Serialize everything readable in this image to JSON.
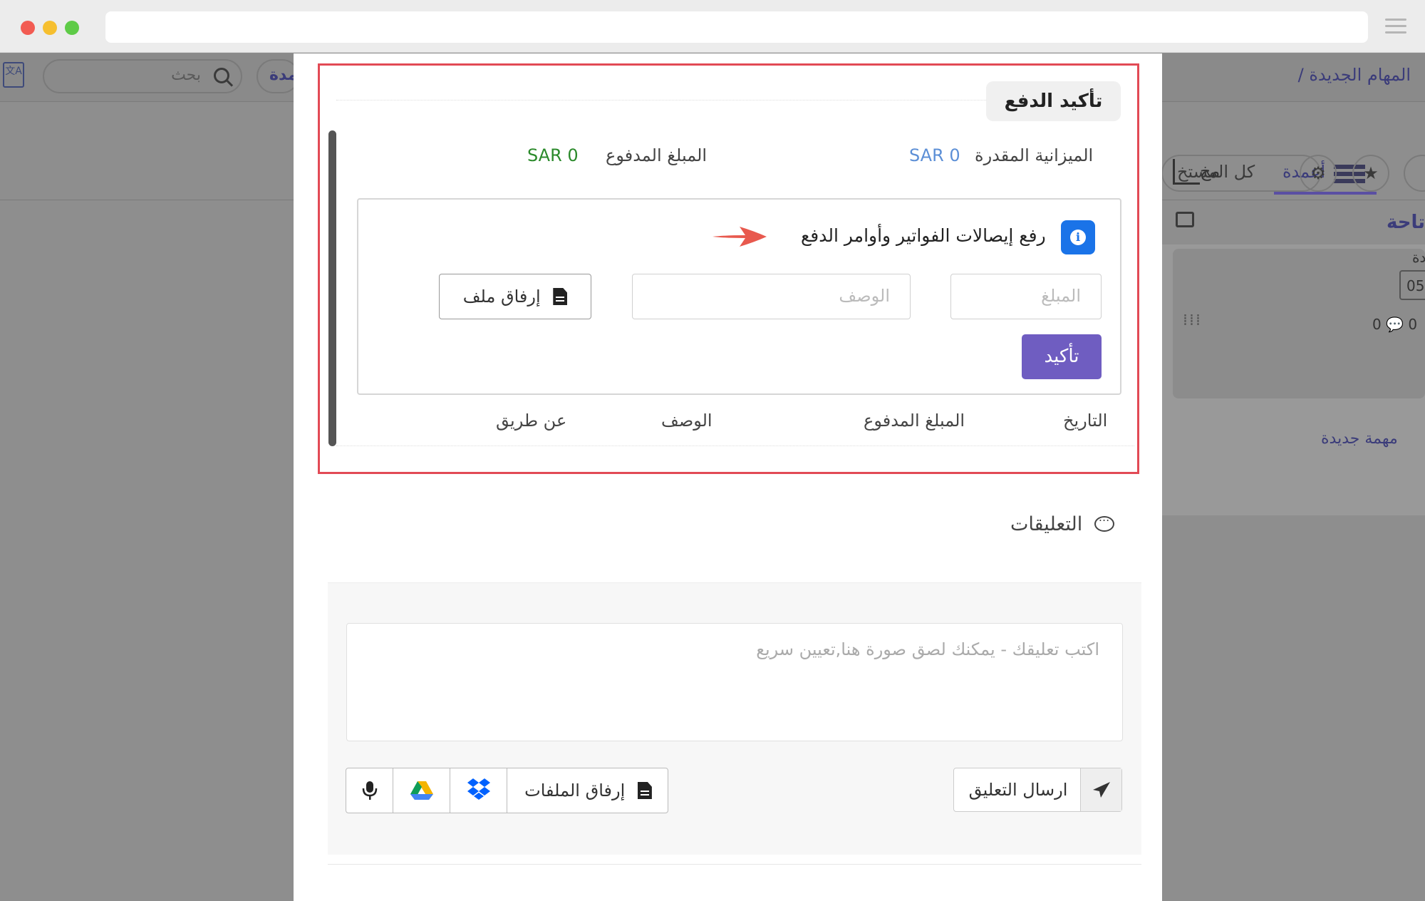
{
  "background_app": {
    "search_placeholder": "بحث",
    "columns_pill_partial": "مدة",
    "breadcrumb": "/ المهام الجديدة",
    "tab_columns": "أعمدة",
    "tab_other_partial": "مخ",
    "all_users_partial": "كل المستخ",
    "card_title_partial": "تاحة",
    "card_label_partial": "دة",
    "card_value_partial": "05",
    "card_comment_count": "0",
    "card_other_count": "0",
    "new_task_link": "مهمة جديدة"
  },
  "payment": {
    "section_title": "تأكيد الدفع",
    "estimated_budget_label": "الميزانية المقدرة",
    "estimated_budget_value": "SAR 0",
    "paid_amount_label": "المبلغ المدفوع",
    "paid_amount_value": "SAR 0",
    "upload_title": "رفع إيصالات الفواتير وأوامر الدفع",
    "amount_placeholder": "المبلغ",
    "description_placeholder": "الوصف",
    "attach_file_label": "إرفاق ملف",
    "confirm_label": "تأكيد",
    "table_headers": [
      "التاريخ",
      "المبلغ المدفوع",
      "الوصف",
      "عن طريق"
    ]
  },
  "comments": {
    "title": "التعليقات",
    "input_placeholder": "اكتب تعليقك - يمكنك لصق صورة هنا,تعيين سريع",
    "send_label": "ارسال التعليق",
    "attach_files_label": "إرفاق الملفات"
  },
  "colors": {
    "highlight_border": "#e24a55",
    "confirm_button": "#6f5dc1",
    "info_icon": "#1a73e8",
    "budget_value": "#5c8fd6",
    "paid_value": "#2b8a2b",
    "arrow": "#e8594e"
  },
  "icons": {
    "info": "info-icon",
    "arrow": "arrow-right-icon",
    "attach": "document-icon",
    "comment": "comment-icon",
    "send": "paper-plane-icon",
    "dropbox": "dropbox-icon",
    "google_drive": "google-drive-icon",
    "microphone": "microphone-icon"
  }
}
